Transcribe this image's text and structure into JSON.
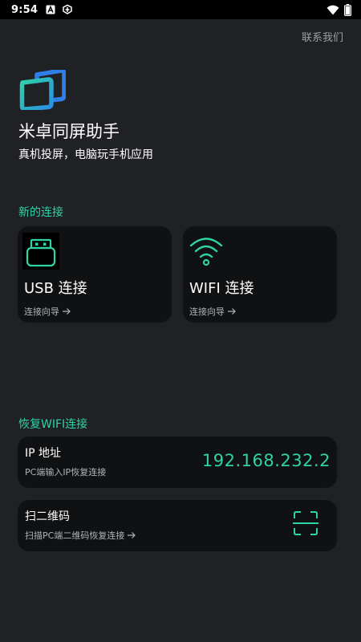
{
  "status_bar": {
    "time": "9:54",
    "left_icons": [
      "a-box-icon",
      "tiktok-icon"
    ],
    "right_icons": [
      "wifi-icon",
      "battery-icon"
    ]
  },
  "header": {
    "contact_label": "联系我们"
  },
  "app": {
    "title": "米卓同屏助手",
    "subtitle": "真机投屏，电脑玩手机应用"
  },
  "new_connection": {
    "section_title": "新的连接",
    "cards": [
      {
        "title": "USB 连接",
        "guide": "连接向导",
        "icon": "usb-stick-icon"
      },
      {
        "title": "WIFI 连接",
        "guide": "连接向导",
        "icon": "wifi-signal-icon"
      }
    ]
  },
  "restore_wifi": {
    "section_title": "恢复WIFI连接",
    "ip_row": {
      "title": "IP 地址",
      "subtitle": "PC端输入IP恢复连接",
      "value": "192.168.232.2"
    },
    "qr_row": {
      "title": "扫二维码",
      "subtitle": "扫描PC端二维码恢复连接",
      "icon": "scan-frame-icon"
    }
  },
  "colors": {
    "accent": "#2ed3a6",
    "background": "#202124",
    "card": "#101113"
  }
}
